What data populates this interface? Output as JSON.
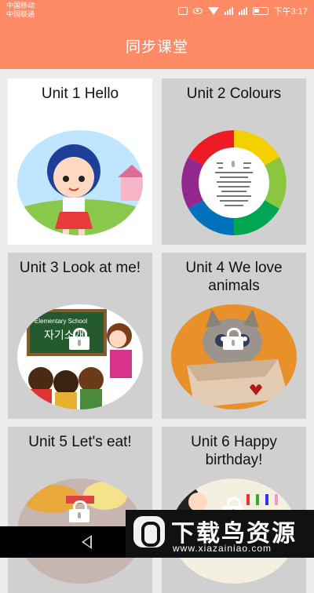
{
  "status_bar": {
    "carrier_1": "中国移动",
    "carrier_2": "中国联通",
    "time": "下午3:17"
  },
  "app_bar": {
    "title": "同步课堂"
  },
  "units": [
    {
      "title": "Unit 1 Hello",
      "locked": false
    },
    {
      "title": "Unit 2 Colours",
      "locked": true
    },
    {
      "title": "Unit 3 Look at me!",
      "locked": true
    },
    {
      "title": "Unit 4 We love animals",
      "locked": true
    },
    {
      "title": "Unit 5 Let's eat!",
      "locked": true
    },
    {
      "title": "Unit 6 Happy birthday!",
      "locked": true
    }
  ],
  "thumbnails": {
    "unit3_board_text_line1": "Elementary School",
    "unit3_board_text_line2": "자기소개"
  },
  "watermark": {
    "name": "下载鸟资源",
    "url": "www.xiazainiao.com"
  },
  "colors": {
    "accent": "#ff8a66",
    "card_locked": "#d0d0d0",
    "card_active": "#ffffff"
  },
  "icons": [
    "back-icon",
    "lock-icon",
    "wifi-icon",
    "battery-icon",
    "signal-icon",
    "eye-icon",
    "vibrate-icon"
  ]
}
